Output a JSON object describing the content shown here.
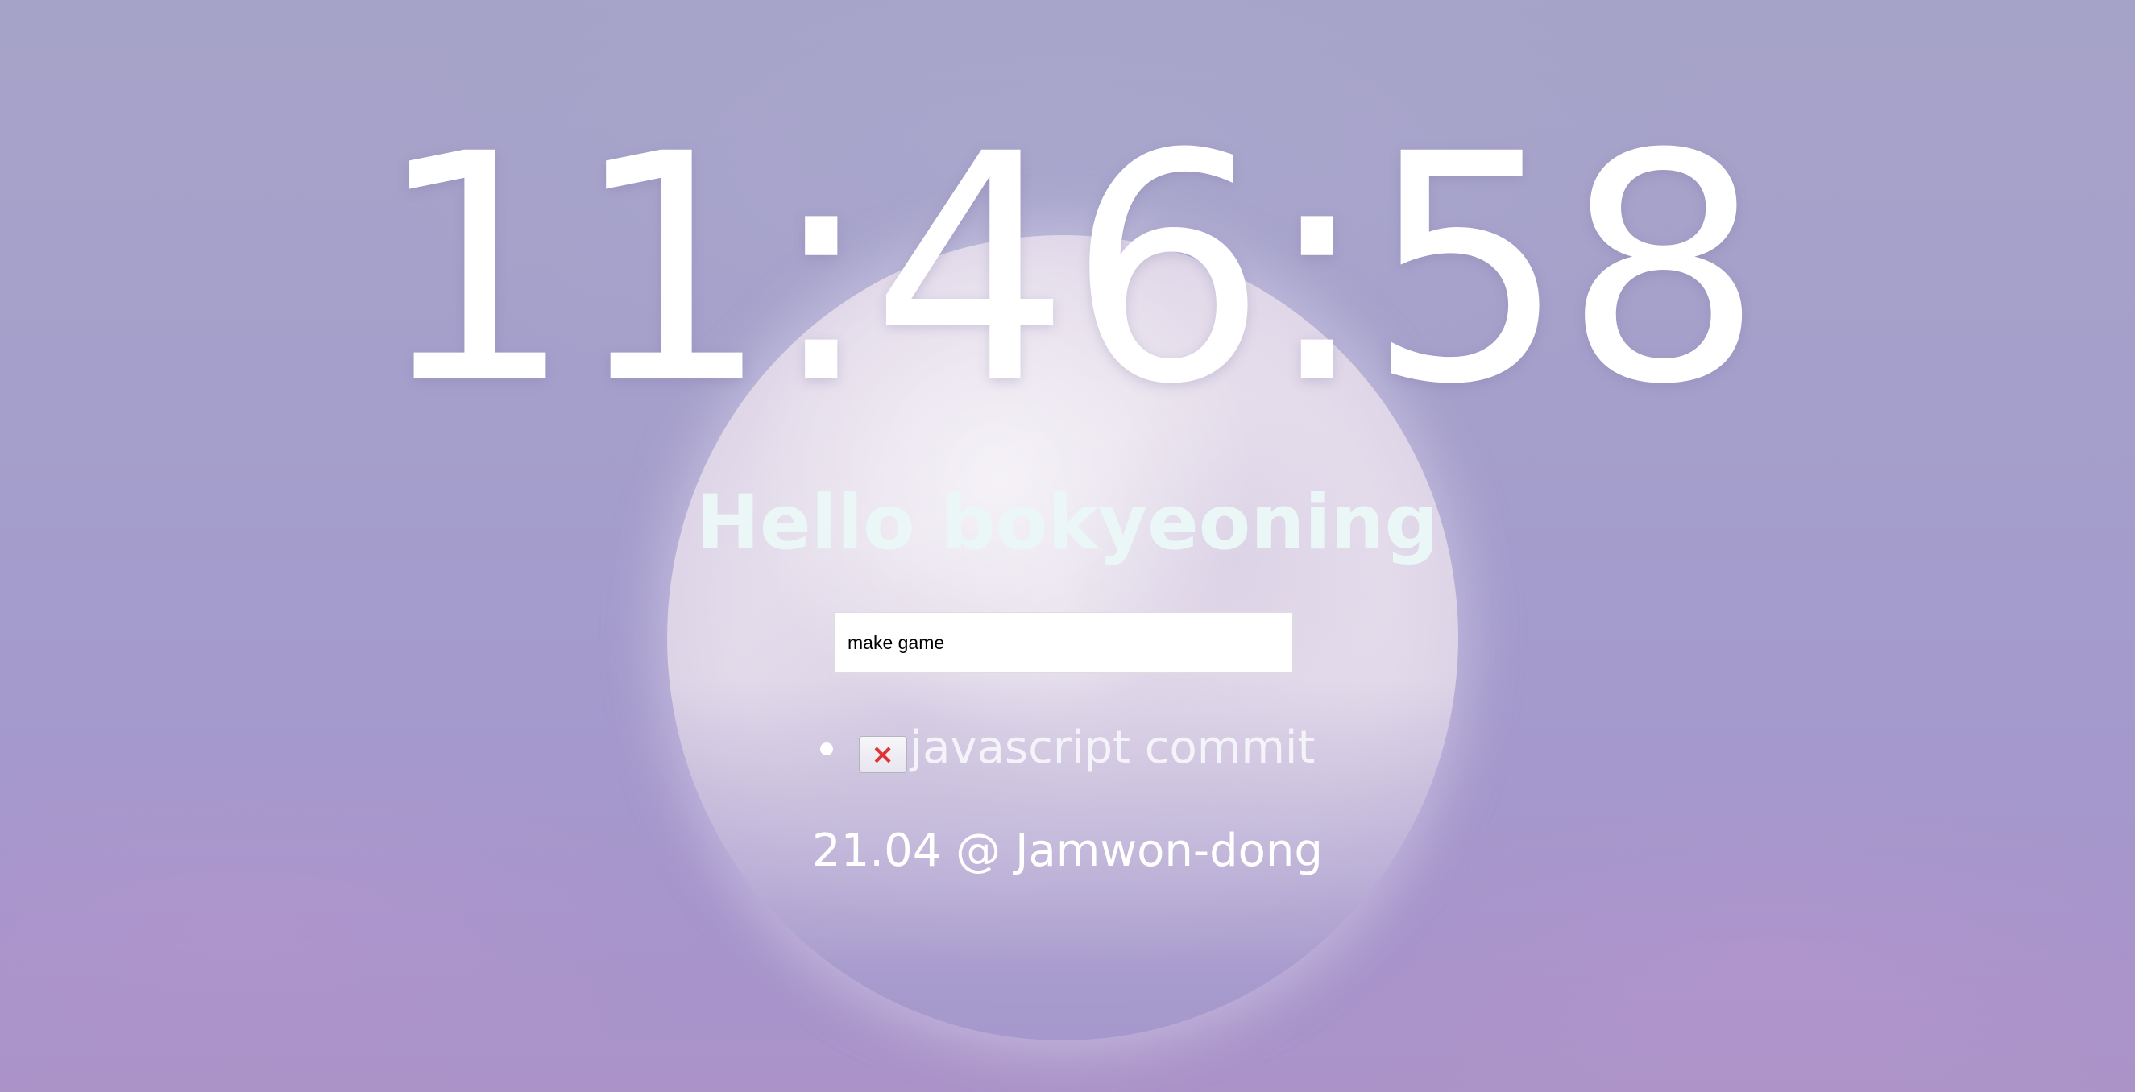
{
  "clock": {
    "time": "11:46:58"
  },
  "greeting": {
    "text": "Hello bokyeoning"
  },
  "todo_form": {
    "input_value": "make game"
  },
  "todo_list": {
    "items": [
      {
        "text": "javascript commit",
        "delete_symbol": "×"
      }
    ]
  },
  "weather": {
    "text": "21.04 @ Jamwon-dong"
  },
  "background": {
    "subject": "moon-icon",
    "sky_color": "#a6a0cb",
    "moon_color": "#e6dfed"
  }
}
